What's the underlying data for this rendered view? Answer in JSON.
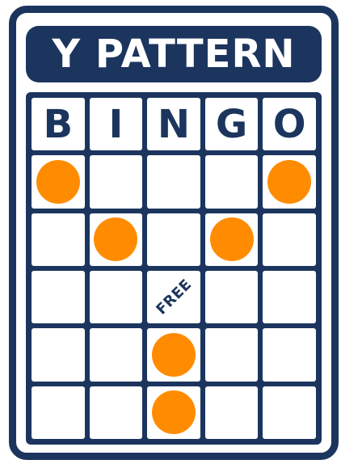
{
  "title": "Y PATTERN",
  "header_letters": [
    "B",
    "I",
    "N",
    "G",
    "O"
  ],
  "free_label": "FREE",
  "colors": {
    "navy": "#1c355e",
    "marker": "#ff8c00",
    "cell": "#ffffff"
  },
  "marked": [
    [
      true,
      false,
      false,
      false,
      true
    ],
    [
      false,
      true,
      false,
      true,
      false
    ],
    [
      false,
      false,
      false,
      false,
      false
    ],
    [
      false,
      false,
      true,
      false,
      false
    ],
    [
      false,
      false,
      true,
      false,
      false
    ]
  ],
  "free_cell": {
    "row": 2,
    "col": 2
  }
}
